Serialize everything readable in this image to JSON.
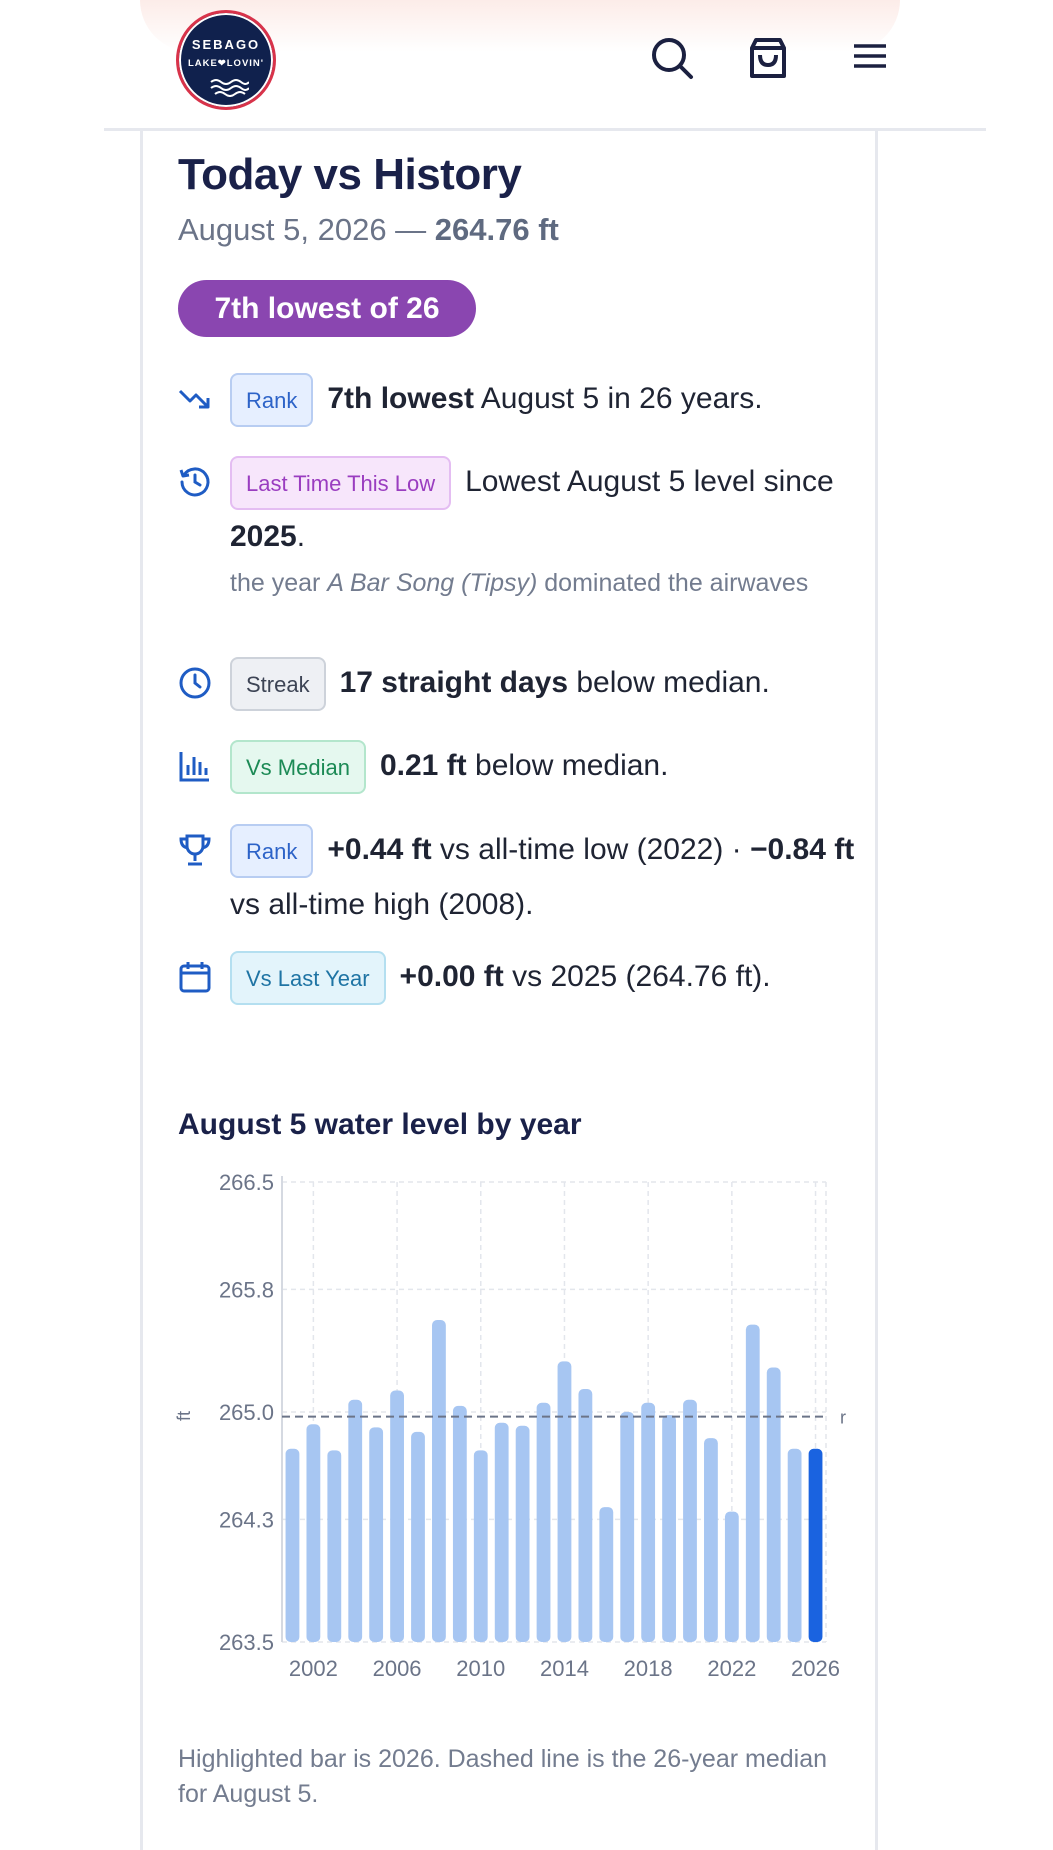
{
  "brand": {
    "line1": "SEBAGO",
    "line2": "LAKE❤LOVIN'"
  },
  "header_icons": [
    "search-icon",
    "shopping-bag-icon",
    "menu-icon"
  ],
  "title": "Today vs History",
  "subtitle": {
    "date": "August 5, 2026 — ",
    "level": "264.76 ft"
  },
  "rank_pill": "7th lowest of 26",
  "rows": [
    {
      "icon": "trending-down-icon",
      "badge": "Rank",
      "bold": "7th lowest",
      "text": " August 5 in 26 years."
    },
    {
      "icon": "history-icon",
      "badge": "Last Time This Low",
      "text1": "Lowest August 5 level since ",
      "bold": "2025",
      "text2": ".",
      "note_pre": "the year ",
      "note_em": "A Bar Song (Tipsy)",
      "note_post": " dominated the airwaves"
    },
    {
      "icon": "clock-icon",
      "badge": "Streak",
      "bold": "17 straight days",
      "text": " below median."
    },
    {
      "icon": "bar-chart-icon",
      "badge": "Vs Median",
      "bold": "0.21 ft",
      "text": " below median."
    },
    {
      "icon": "trophy-icon",
      "badge": "Rank",
      "bold1": "+0.44 ft",
      "text1": " vs all-time low (2022) · ",
      "bold2": "−0.84 ft",
      "text2": " vs all-time high (2008)."
    },
    {
      "icon": "calendar-icon",
      "badge": "Vs Last Year",
      "bold": "+0.00 ft",
      "text": " vs 2025 (264.76 ft)."
    }
  ],
  "chart_title": "August 5 water level by year",
  "chart_data": {
    "type": "bar",
    "ylabel": "ft",
    "ylim": [
      263.5,
      266.5
    ],
    "yticks": [
      "266.5",
      "265.8",
      "265.0",
      "264.3",
      "263.5"
    ],
    "xticks": [
      "2002",
      "2006",
      "2010",
      "2014",
      "2018",
      "2022",
      "2026"
    ],
    "median": 264.97,
    "median_label": "r",
    "highlight": 2026,
    "colors": {
      "bar": "#a7c6f2",
      "highlight": "#1a63e0",
      "median": "#6b7488"
    },
    "series": [
      {
        "x": [
          2001,
          2002,
          2003,
          2004,
          2005,
          2006,
          2007,
          2008,
          2009,
          2010,
          2011,
          2012,
          2013,
          2014,
          2015,
          2016,
          2017,
          2018,
          2019,
          2020,
          2021,
          2022,
          2023,
          2024,
          2025,
          2026
        ],
        "values": [
          264.76,
          264.92,
          264.75,
          265.08,
          264.9,
          265.14,
          264.87,
          265.6,
          265.04,
          264.75,
          264.93,
          264.91,
          265.06,
          265.33,
          265.15,
          264.38,
          265.0,
          265.06,
          264.98,
          265.08,
          264.83,
          264.35,
          265.57,
          265.29,
          264.76,
          264.76
        ]
      }
    ]
  },
  "caption": "Highlighted bar is 2026. Dashed line is the 26-year median for August 5."
}
